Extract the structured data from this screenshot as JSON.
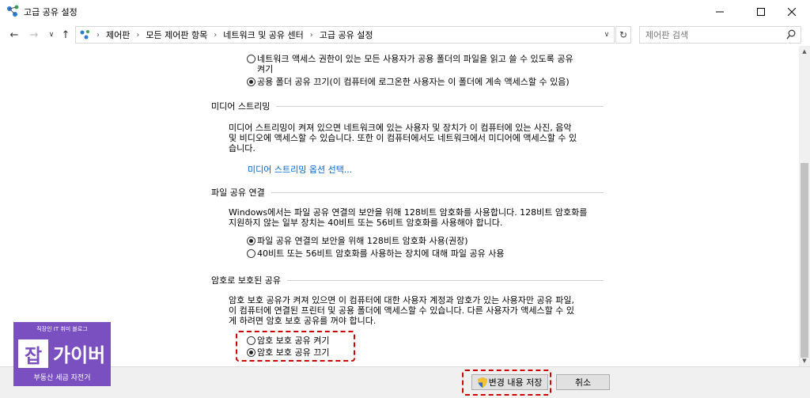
{
  "window": {
    "title": "고급 공유 설정"
  },
  "address": {
    "crumbs": [
      "제어판",
      "모든 제어판 항목",
      "네트워크 및 공유 센터",
      "고급 공유 설정"
    ]
  },
  "search": {
    "placeholder": "제어판 검색"
  },
  "public_folder": {
    "option_on_line1": "네트워크 액세스 권한이 있는 모든 사용자가 공용 폴더의 파일을 읽고 쓸 수 있도록 공유",
    "option_on_line2": "켜기",
    "option_off": "공용 폴더 공유 끄기(이 컴퓨터에 로그온한 사용자는 이 폴더에 계속 액세스할 수 있음)",
    "selected": "off"
  },
  "media": {
    "header": "미디어 스트리밍",
    "line1": "미디어 스트리밍이 켜져 있으면 네트워크에 있는 사용자 및 장치가 이 컴퓨터에 있는 사진, 음악",
    "line2": "및 비디오에 액세스할 수 있습니다. 또한 이 컴퓨터에서도 네트워크에서 미디어에 액세스할 수 있",
    "line3": "습니다.",
    "link": "미디어 스트리밍 옵션 선택..."
  },
  "file_sharing": {
    "header": "파일 공유 연결",
    "line1": "Windows에서는 파일 공유 연결의 보안을 위해 128비트 암호화를 사용합니다. 128비트 암호화를",
    "line2": "지원하지 않는 일부 장치는 40비트 또는 56비트 암호화를 사용해야 합니다.",
    "option_128": "파일 공유 연결의 보안을 위해 128비트 암호화 사용(권장)",
    "option_40": "40비트 또는 56비트 암호화를 사용하는 장치에 대해 파일 공유 사용",
    "selected": "128"
  },
  "password": {
    "header": "암호로 보호된 공유",
    "line1": "암호 보호 공유가 켜져 있으면 이 컴퓨터에 대한 사용자 계정과 암호가 있는 사용자만 공유 파일,",
    "line2": "이 컴퓨터에 연결된 프린터 및 공용 폴더에 액세스할 수 있습니다. 다른 사용자가 액세스할 수 있",
    "line3": "게 하려면 암호 보호 공유를 꺼야 합니다.",
    "option_on": "암호 보호 공유 켜기",
    "option_off": "암호 보호 공유 끄기",
    "selected": "off"
  },
  "buttons": {
    "save": "변경 내용 저장",
    "cancel": "취소"
  },
  "watermark": {
    "top": "직장인 IT 취미 블로그",
    "big1": "잡",
    "big2": "가이버",
    "bottom": "부동산 세금 자전거"
  },
  "colors": {
    "link": "#0066cc",
    "highlight": "#cc0000",
    "logo": "#7a4fc0"
  }
}
